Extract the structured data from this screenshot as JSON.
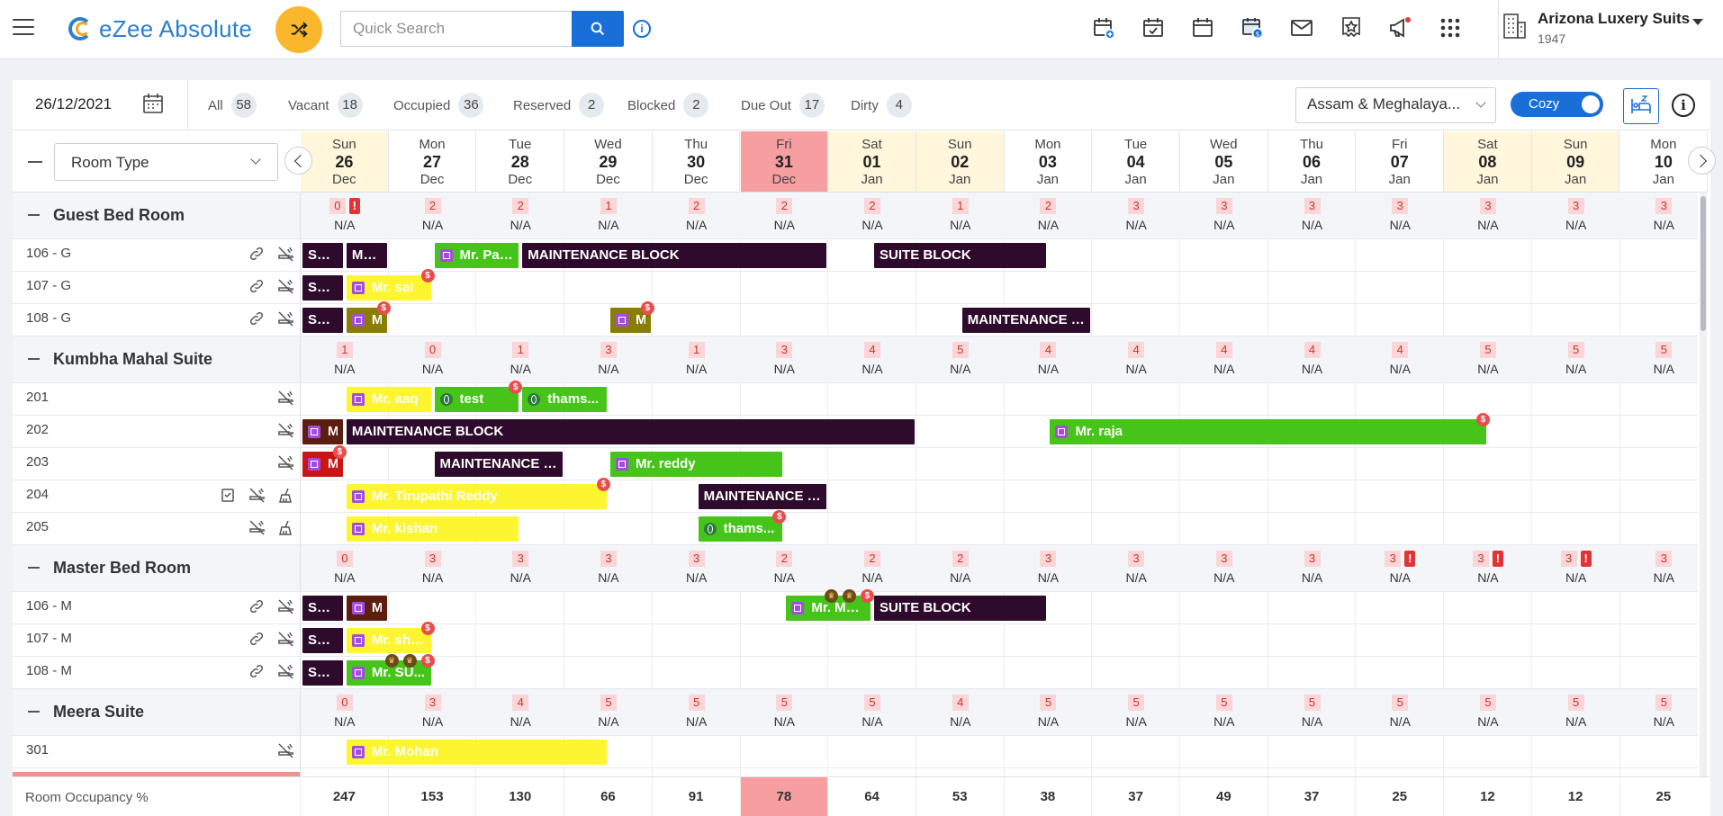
{
  "app": {
    "brand": "eZee Absolute",
    "search_placeholder": "Quick Search",
    "hotel_name": "Arizona Luxery Suits",
    "hotel_code": "1947",
    "info_glyph": "i",
    "top_icons": [
      "calendar-add-icon",
      "calendar-check-icon",
      "calendar-icon",
      "calendar-dollar-icon",
      "mail-icon",
      "star-review-icon",
      "megaphone-icon",
      "apps-grid-icon"
    ]
  },
  "filters": {
    "date": "26/12/2021",
    "items": [
      {
        "label": "All",
        "count": "58"
      },
      {
        "label": "Vacant",
        "count": "18"
      },
      {
        "label": "Occupied",
        "count": "36"
      },
      {
        "label": "Reserved",
        "count": "2"
      },
      {
        "label": "Blocked",
        "count": "2"
      },
      {
        "label": "Due Out",
        "count": "17"
      },
      {
        "label": "Dirty",
        "count": "4"
      }
    ],
    "region": "Assam & Meghalaya...",
    "view_toggle": "Cozy"
  },
  "grid": {
    "room_type_select": "Room Type",
    "dates": [
      {
        "dow": "Sun",
        "day": "26",
        "mon": "Dec",
        "type": "weekend"
      },
      {
        "dow": "Mon",
        "day": "27",
        "mon": "Dec",
        "type": "normal"
      },
      {
        "dow": "Tue",
        "day": "28",
        "mon": "Dec",
        "type": "normal"
      },
      {
        "dow": "Wed",
        "day": "29",
        "mon": "Dec",
        "type": "normal"
      },
      {
        "dow": "Thu",
        "day": "30",
        "mon": "Dec",
        "type": "normal"
      },
      {
        "dow": "Fri",
        "day": "31",
        "mon": "Dec",
        "type": "today"
      },
      {
        "dow": "Sat",
        "day": "01",
        "mon": "Jan",
        "type": "weekend"
      },
      {
        "dow": "Sun",
        "day": "02",
        "mon": "Jan",
        "type": "weekend"
      },
      {
        "dow": "Mon",
        "day": "03",
        "mon": "Jan",
        "type": "normal"
      },
      {
        "dow": "Tue",
        "day": "04",
        "mon": "Jan",
        "type": "normal"
      },
      {
        "dow": "Wed",
        "day": "05",
        "mon": "Jan",
        "type": "normal"
      },
      {
        "dow": "Thu",
        "day": "06",
        "mon": "Jan",
        "type": "normal"
      },
      {
        "dow": "Fri",
        "day": "07",
        "mon": "Jan",
        "type": "normal"
      },
      {
        "dow": "Sat",
        "day": "08",
        "mon": "Jan",
        "type": "weekend"
      },
      {
        "dow": "Sun",
        "day": "09",
        "mon": "Jan",
        "type": "weekend"
      },
      {
        "dow": "Mon",
        "day": "10",
        "mon": "Jan",
        "type": "normal"
      }
    ],
    "na_text": "N/A",
    "colors": {
      "weekend": "#fff6dc",
      "today": "#f69ea0",
      "group_bg": "#f3f5f8",
      "dark_block": "#2e0a2c",
      "green": "#46c41a",
      "yellow": "#fdf52f",
      "accent": "#1a6ed8"
    },
    "groups": [
      {
        "name": "Guest Bed Room",
        "avail": [
          "0",
          "2",
          "2",
          "1",
          "2",
          "2",
          "2",
          "1",
          "2",
          "3",
          "3",
          "3",
          "3",
          "3",
          "3",
          "3"
        ],
        "alerts": [
          0
        ],
        "rooms": [
          {
            "name": "106 - G",
            "icons": [
              "link-icon",
              "no-smoking-icon"
            ],
            "bookings": [
              {
                "label": "SUI...",
                "style": "dark",
                "start": 0,
                "end": 0.5
              },
              {
                "label": "MA...",
                "style": "dark",
                "start": 0.5,
                "end": 1
              },
              {
                "label": "Mr. Par...",
                "style": "green",
                "icon": "building",
                "start": 1.5,
                "end": 2.5
              },
              {
                "label": "MAINTENANCE BLOCK",
                "style": "dark",
                "start": 2.5,
                "end": 6
              },
              {
                "label": "SUITE BLOCK",
                "style": "dark",
                "start": 6.5,
                "end": 8.5
              }
            ]
          },
          {
            "name": "107 - G",
            "icons": [
              "link-icon",
              "no-smoking-icon"
            ],
            "bookings": [
              {
                "label": "SUI...",
                "style": "dark",
                "start": 0,
                "end": 0.5
              },
              {
                "label": "Mr. sai",
                "style": "yellow",
                "icon": "building",
                "start": 0.5,
                "end": 1.5,
                "dollar": true
              }
            ]
          },
          {
            "name": "108 - G",
            "icons": [
              "link-icon",
              "no-smoking-icon"
            ],
            "bookings": [
              {
                "label": "SUI...",
                "style": "dark",
                "start": 0,
                "end": 0.5
              },
              {
                "label": "M",
                "style": "olive",
                "icon": "building",
                "start": 0.5,
                "end": 1,
                "dollar": true
              },
              {
                "label": "M",
                "style": "olive",
                "icon": "building",
                "start": 3.5,
                "end": 4,
                "dollar": true
              },
              {
                "label": "MAINTENANCE B...",
                "style": "dark",
                "start": 7.5,
                "end": 9
              }
            ]
          }
        ]
      },
      {
        "name": "Kumbha Mahal Suite",
        "avail": [
          "1",
          "0",
          "1",
          "3",
          "1",
          "3",
          "4",
          "5",
          "4",
          "4",
          "4",
          "4",
          "4",
          "5",
          "5",
          "5"
        ],
        "alerts": [],
        "rooms": [
          {
            "name": "201",
            "icons": [
              "no-smoking-icon"
            ],
            "bookings": [
              {
                "label": "Mr. aaq",
                "style": "yellow",
                "icon": "building",
                "start": 0.5,
                "end": 1.5
              },
              {
                "label": "test",
                "style": "green",
                "icon": "globe",
                "start": 1.5,
                "end": 2.5,
                "dollar": true
              },
              {
                "label": "thams...",
                "style": "green",
                "icon": "globe",
                "start": 2.5,
                "end": 3.5
              }
            ]
          },
          {
            "name": "202",
            "icons": [
              "no-smoking-icon"
            ],
            "bookings": [
              {
                "label": "M",
                "style": "brown",
                "icon": "building",
                "start": 0,
                "end": 0.5
              },
              {
                "label": "MAINTENANCE BLOCK",
                "style": "dark",
                "start": 0.5,
                "end": 7
              },
              {
                "label": "Mr. raja",
                "style": "green",
                "icon": "building",
                "start": 8.5,
                "end": 13.5,
                "dollar": true
              }
            ]
          },
          {
            "name": "203",
            "icons": [
              "no-smoking-icon"
            ],
            "bookings": [
              {
                "label": "M",
                "style": "red",
                "icon": "building",
                "start": 0,
                "end": 0.5,
                "dollar": true
              },
              {
                "label": "MAINTENANCE B...",
                "style": "dark",
                "start": 1.5,
                "end": 3
              },
              {
                "label": "Mr. reddy",
                "style": "green",
                "icon": "building",
                "start": 3.5,
                "end": 5.5
              }
            ]
          },
          {
            "name": "204",
            "icons": [
              "task-icon",
              "no-smoking-icon",
              "broom-icon"
            ],
            "bookings": [
              {
                "label": "Mr. Tirupathi Reddy",
                "style": "yellow",
                "icon": "building",
                "start": 0.5,
                "end": 3.5,
                "dollar": true
              },
              {
                "label": "MAINTENANCE B...",
                "style": "dark",
                "start": 4.5,
                "end": 6
              }
            ]
          },
          {
            "name": "205",
            "icons": [
              "no-smoking-icon",
              "broom-icon"
            ],
            "bookings": [
              {
                "label": "Mr. kishan",
                "style": "yellow",
                "icon": "building",
                "start": 0.5,
                "end": 2.5
              },
              {
                "label": "thams...",
                "style": "green",
                "icon": "globe",
                "start": 4.5,
                "end": 5.5,
                "dollar": true
              }
            ]
          }
        ]
      },
      {
        "name": "Master Bed Room",
        "avail": [
          "0",
          "3",
          "3",
          "3",
          "3",
          "2",
          "2",
          "2",
          "3",
          "3",
          "3",
          "3",
          "3",
          "3",
          "3",
          "3"
        ],
        "alerts": [
          12,
          13,
          14
        ],
        "rooms": [
          {
            "name": "106 - M",
            "icons": [
              "link-icon",
              "no-smoking-icon"
            ],
            "bookings": [
              {
                "label": "SUI...",
                "style": "dark",
                "start": 0,
                "end": 0.5
              },
              {
                "label": "M",
                "style": "brown",
                "icon": "building",
                "start": 0.5,
                "end": 1
              },
              {
                "label": "Mr. Mo...",
                "style": "green",
                "icon": "building",
                "start": 5.5,
                "end": 6.5,
                "dollar": true,
                "crown": true
              },
              {
                "label": "SUITE BLOCK",
                "style": "dark",
                "start": 6.5,
                "end": 8.5
              }
            ]
          },
          {
            "name": "107 - M",
            "icons": [
              "link-icon",
              "no-smoking-icon"
            ],
            "bookings": [
              {
                "label": "SUI...",
                "style": "dark",
                "start": 0,
                "end": 0.5
              },
              {
                "label": "Mr. shi...",
                "style": "yellow",
                "icon": "building",
                "start": 0.5,
                "end": 1.5,
                "dollar": true
              }
            ]
          },
          {
            "name": "108 - M",
            "icons": [
              "link-icon",
              "no-smoking-icon"
            ],
            "bookings": [
              {
                "label": "SUI...",
                "style": "dark",
                "start": 0,
                "end": 0.5
              },
              {
                "label": "Mr. SU...",
                "style": "green",
                "icon": "building",
                "start": 0.5,
                "end": 1.5,
                "dollar": true,
                "crown": true
              }
            ]
          }
        ]
      },
      {
        "name": "Meera Suite",
        "avail": [
          "0",
          "3",
          "4",
          "5",
          "5",
          "5",
          "5",
          "4",
          "5",
          "5",
          "5",
          "5",
          "5",
          "5",
          "5",
          "5"
        ],
        "alerts": [],
        "rooms": [
          {
            "name": "301",
            "icons": [
              "no-smoking-icon"
            ],
            "bookings": [
              {
                "label": "Mr. Mohan",
                "style": "yellow",
                "icon": "building",
                "start": 0.5,
                "end": 3.5
              }
            ]
          }
        ]
      }
    ],
    "occupancy_label": "Room Occupancy %",
    "occupancy": [
      "247",
      "153",
      "130",
      "66",
      "91",
      "78",
      "64",
      "53",
      "38",
      "37",
      "49",
      "37",
      "25",
      "12",
      "12",
      "25"
    ]
  }
}
